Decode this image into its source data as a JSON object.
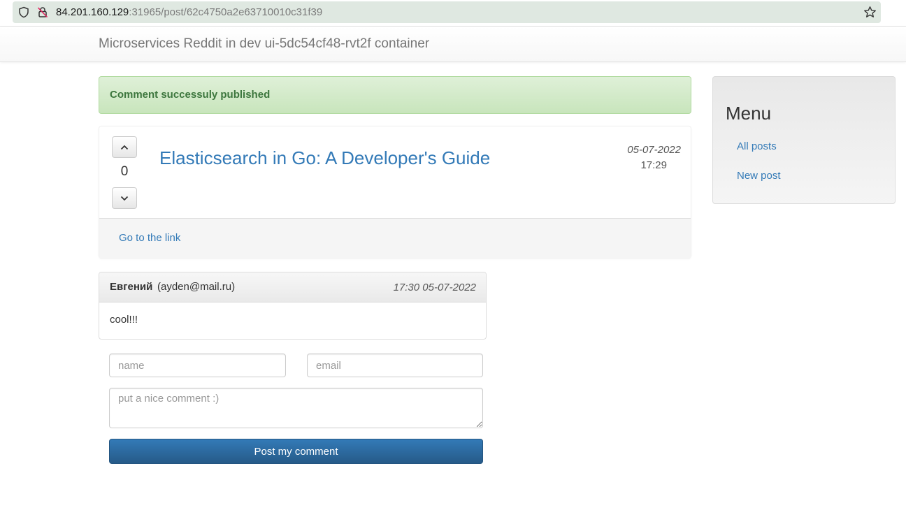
{
  "browser": {
    "url_host": "84.201.160.129",
    "url_path": ":31965/post/62c4750a2e63710010c31f39"
  },
  "navbar": {
    "brand": "Microservices Reddit in dev ui-5dc54cf48-rvt2f container"
  },
  "alert": {
    "message": "Comment successuly published",
    "color": "#3c763d"
  },
  "post": {
    "votes": "0",
    "title": "Elasticsearch in Go: A Developer's Guide",
    "date": "05-07-2022",
    "time": "17:29",
    "link_label": "Go to the link"
  },
  "comments": [
    {
      "author": "Евгений",
      "email": "(ayden@mail.ru)",
      "timestamp": "17:30 05-07-2022",
      "body": "cool!!!"
    }
  ],
  "form": {
    "name_placeholder": "name",
    "email_placeholder": "email",
    "comment_placeholder": "put a nice comment :)",
    "submit_label": "Post my comment"
  },
  "sidebar": {
    "title": "Menu",
    "links": [
      {
        "label": "All posts"
      },
      {
        "label": "New post"
      }
    ]
  },
  "colors": {
    "link": "#337ab7",
    "primary_button": "#2e6da4"
  }
}
